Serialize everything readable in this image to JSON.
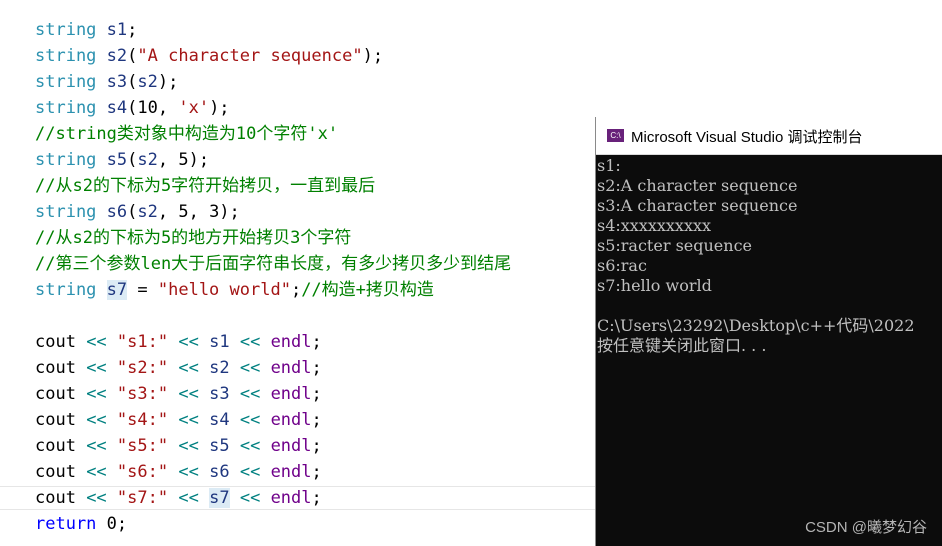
{
  "editor": {
    "lines": [
      "string s1;",
      "string s2(\"A character sequence\");",
      "string s3(s2);",
      "string s4(10, 'x');",
      "//string类对象中构造为10个字符'x'",
      "string s5(s2, 5);",
      "//从s2的下标为5字符开始拷贝，一直到最后",
      "string s6(s2, 5, 3);",
      "//从s2的下标为5的地方开始拷贝3个字符",
      "//第三个参数len大于后面字符串长度，有多少拷贝多少到结尾",
      "string s7 = \"hello world\";//构造+拷贝构造",
      "",
      "cout << \"s1:\" << s1 << endl;",
      "cout << \"s2:\" << s2 << endl;",
      "cout << \"s3:\" << s3 << endl;",
      "cout << \"s4:\" << s4 << endl;",
      "cout << \"s5:\" << s5 << endl;",
      "cout << \"s6:\" << s6 << endl;",
      "cout << \"s7:\" << s7 << endl;",
      "return 0;"
    ],
    "highlighted_identifier": "s7"
  },
  "console": {
    "icon_text": "C:\\",
    "title": "Microsoft Visual Studio 调试控制台",
    "output": [
      "s1:",
      "s2:A character sequence",
      "s3:A character sequence",
      "s4:xxxxxxxxxx",
      "s5:racter sequence",
      "s6:rac",
      "s7:hello world",
      "",
      "C:\\Users\\23292\\Desktop\\c++代码\\2022",
      "按任意键关闭此窗口. . ."
    ]
  },
  "watermark": "CSDN @曦梦幻谷",
  "colors": {
    "keyword": "#0000ff",
    "type": "#2b91af",
    "comment": "#008000",
    "string": "#a31515",
    "variable": "#1f377f",
    "macro": "#6f008a",
    "console_bg": "#0c0c0c",
    "console_text": "#c0c0c0"
  }
}
